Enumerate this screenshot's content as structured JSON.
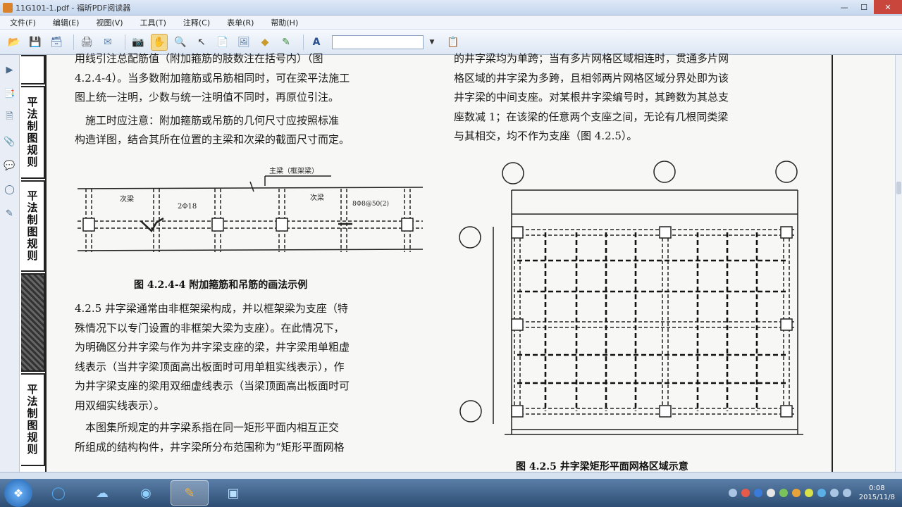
{
  "window": {
    "title": "11G101-1.pdf - 福昕PDF阅读器"
  },
  "menu": [
    "文件(F)",
    "编辑(E)",
    "视图(V)",
    "工具(T)",
    "注释(C)",
    "表单(R)",
    "帮助(H)"
  ],
  "tabs": [
    "平法制图规则",
    "平法制图规则",
    "平法制图规则"
  ],
  "left_column": {
    "lines": [
      "用线引注总配筋值（附加箍筋的肢数注在括号内）（图",
      "4.2.4-4）。当多数附加箍筋或吊筋相同时，可在梁平法施工",
      "图上统一注明，少数与统一注明值不同时，再原位引注。",
      "　施工时应注意：附加箍筋或吊筋的几何尺寸应按照标准",
      "构造详图，结合其所在位置的主梁和次梁的截面尺寸而定。"
    ],
    "figure_labels": {
      "main_beam": "主梁（框架梁）",
      "sec_beam_1": "次梁",
      "sec_beam_2": "次梁",
      "rebar_1": "2Φ18",
      "rebar_2": "8Φ8@50(2)"
    },
    "figure_caption": "图 4.2.4-4  附加箍筋和吊筋的画法示例",
    "lines_2": [
      "4.2.5  井字梁通常由非框架梁构成，并以框架梁为支座（特",
      "殊情况下以专门设置的非框架大梁为支座）。在此情况下，",
      "为明确区分井字梁与作为井字梁支座的梁，井字梁用单粗虚",
      "线表示（当井字梁顶面高出板面时可用单粗实线表示），作",
      "为井字梁支座的梁用双细虚线表示（当梁顶面高出板面时可",
      "用双细实线表示）。",
      "　本图集所规定的井字梁系指在同一矩形平面内相互正交",
      "所组成的结构构件，井字梁所分布范围称为“矩形平面网格"
    ]
  },
  "right_column": {
    "lines": [
      "的井字梁均为单跨；当有多片网格区域相连时，贯通多片网",
      "格区域的井字梁为多跨，且相邻两片网格区域分界处即为该",
      "井字梁的中间支座。对某根井字梁编号时，其跨数为其总支",
      "座数减 1；在该梁的任意两个支座之间，无论有几根同类梁",
      "与其相交，均不作为支座（图 4.2.5）。"
    ],
    "figure_caption": "图 4.2.5  井字梁矩形平面网格区域示意"
  },
  "clock": {
    "time": "0:08",
    "date": "2015/11/8"
  }
}
